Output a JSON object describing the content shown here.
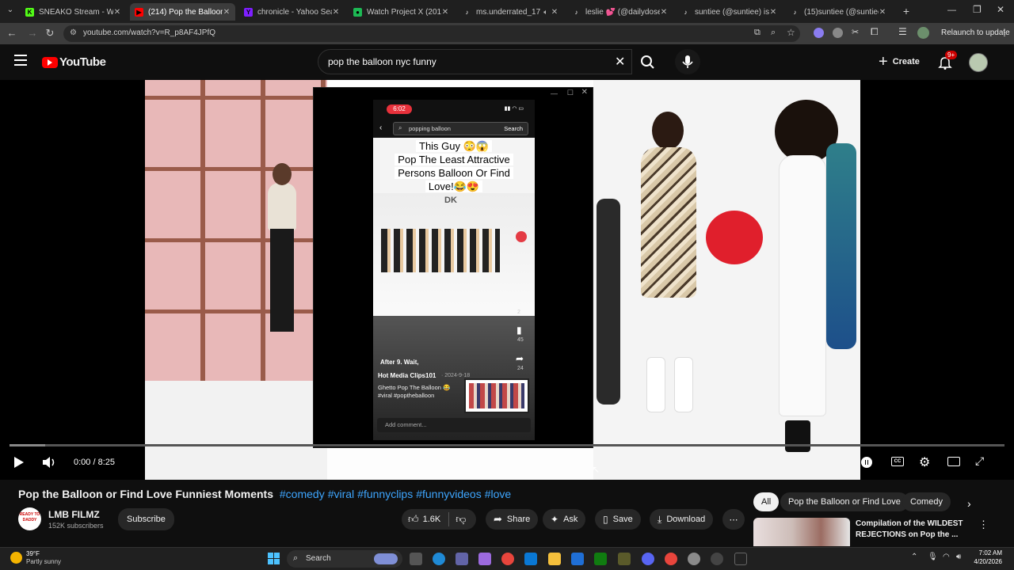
{
  "browser": {
    "tabs": [
      {
        "title": "SNEAKO Stream - Watch",
        "favicon": "kick-icon",
        "color": "#53fc18",
        "glyph": "K"
      },
      {
        "title": "(214) Pop the Balloon or F",
        "favicon": "youtube-icon",
        "color": "#ff0000",
        "glyph": "▶",
        "active": true
      },
      {
        "title": "chronicle - Yahoo Search",
        "favicon": "yahoo-icon",
        "color": "#7e1fff",
        "glyph": "Y"
      },
      {
        "title": "Watch Project X (2012) Fu",
        "favicon": "play-icon",
        "color": "#1db954",
        "glyph": "●"
      },
      {
        "title": "ms.underrated_17 (@",
        "favicon": "tiktok-icon",
        "color": "#ffffff",
        "glyph": "♪"
      },
      {
        "title": "leslie 💕 (@dailydoseofl",
        "favicon": "tiktok-icon",
        "color": "#ffffff",
        "glyph": "♪"
      },
      {
        "title": "suntiee (@suntiee) is LIVE",
        "favicon": "tiktok-icon",
        "color": "#ffffff",
        "glyph": "♪"
      },
      {
        "title": "(15)suntiee (@suntiee) | T",
        "favicon": "tiktok-icon",
        "color": "#ffffff",
        "glyph": "♪"
      }
    ],
    "url": "youtube.com/watch?v=R_p8AF4JPfQ",
    "relaunch_label": "Relaunch to update"
  },
  "youtube": {
    "logo_text": "YouTube",
    "search_value": "pop the balloon nyc funny",
    "create_label": "Create",
    "notif_badge": "9+"
  },
  "player": {
    "time": "0:00 / 8:25",
    "progress": 0.0
  },
  "overlay": {
    "phone_time": "6:02",
    "search_text": "popping balloon",
    "search_btn": "Search",
    "caption_l1": "This Guy 😳😱",
    "caption_l2": "Pop The Least Attractive",
    "caption_l3": "Persons Balloon Or Find",
    "caption_l4": "Love!😂😍",
    "watermark": "DK",
    "after_text": "After 9. Wait,",
    "author": "Hot Media Clips101",
    "date": "· 2024-9-18",
    "desc1": "Ghetto Pop The Balloon 😂",
    "desc2": "#viral #poptheballoon",
    "comment_placeholder": "Add comment...",
    "counts": {
      "comments": "2",
      "saves": "45",
      "shares": "24"
    }
  },
  "video": {
    "title": "Pop the Balloon or Find Love Funniest Moments",
    "hashtags": [
      "#comedy",
      "#viral",
      "#funnyclips",
      "#funnyvideos",
      "#love"
    ],
    "channel_name": "LMB FILMZ",
    "subscribers": "152K subscribers",
    "avatar_text": "READY TO DADDY",
    "subscribe_label": "Subscribe",
    "likes": "1.6K",
    "share_label": "Share",
    "ask_label": "Ask",
    "save_label": "Save",
    "download_label": "Download"
  },
  "sidebar": {
    "chips": [
      "All",
      "Pop the Balloon or Find Love",
      "Comedy"
    ],
    "rec_title_l1": "Compilation of the WILDEST",
    "rec_title_l2": "REJECTIONS on Pop the ..."
  },
  "taskbar": {
    "temp": "39°F",
    "weather": "Partly sunny",
    "search_label": "Search",
    "time": "7:02 AM",
    "date": "4/20/2026"
  },
  "colors": {
    "accent": "#3ea6ff",
    "brand": "#ff0000"
  }
}
